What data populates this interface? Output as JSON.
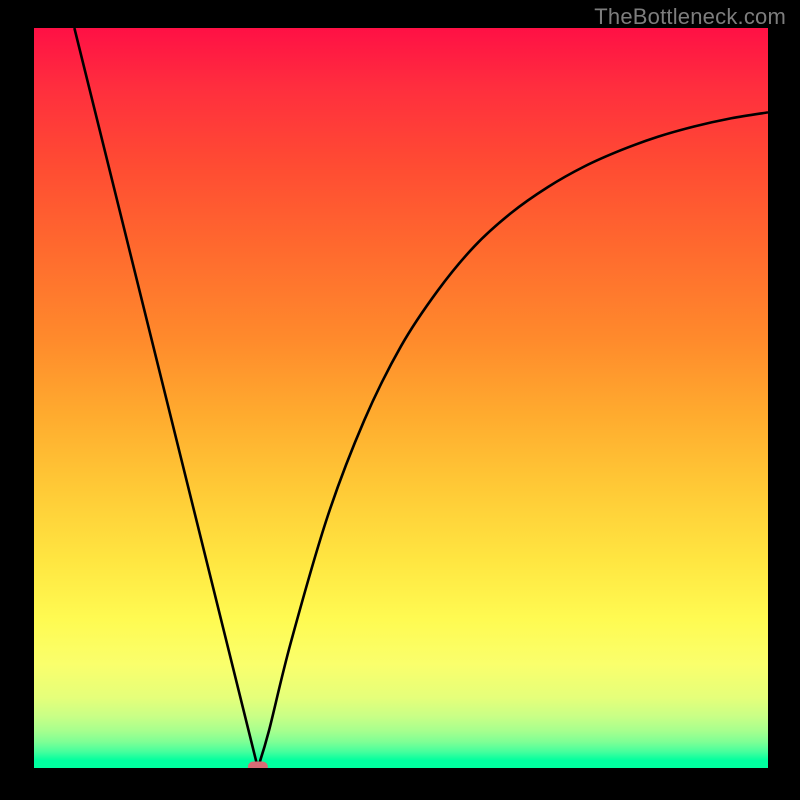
{
  "watermark": "TheBottleneck.com",
  "chart_data": {
    "type": "line",
    "title": "",
    "xlabel": "",
    "ylabel": "",
    "xlim": [
      0,
      100
    ],
    "ylim": [
      0,
      100
    ],
    "background_gradient": {
      "top": "#ff1045",
      "middle_upper": "#ff8a2c",
      "middle_lower": "#fffb52",
      "bottom": "#00ff9f",
      "description": "Vertical gradient from red (high bottleneck) at top through orange and yellow to green (no bottleneck) at bottom"
    },
    "series": [
      {
        "name": "bottleneck-curve",
        "description": "V-shaped curve: steep descending line from top-left to minimum near x≈30, then rising curve approaching top-right",
        "x": [
          5.5,
          10,
          15,
          20,
          25,
          29,
          30.5,
          32,
          35,
          40,
          45,
          50,
          55,
          60,
          65,
          70,
          75,
          80,
          85,
          90,
          95,
          100
        ],
        "y": [
          100,
          82,
          62,
          42,
          22,
          5,
          0,
          5,
          17,
          34,
          47,
          57,
          64.5,
          70.5,
          75,
          78.5,
          81.3,
          83.5,
          85.3,
          86.7,
          87.8,
          88.6
        ]
      }
    ],
    "annotations": [
      {
        "name": "min-marker",
        "type": "marker",
        "x": 30.5,
        "y": 0,
        "shape": "rounded-rect",
        "color": "#d86b75"
      }
    ],
    "grid": false,
    "legend": false
  }
}
